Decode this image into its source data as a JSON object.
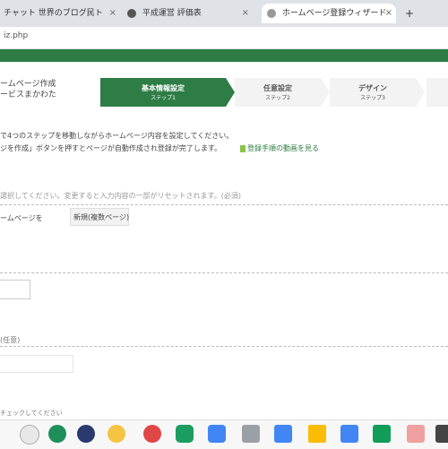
{
  "browser": {
    "tabs": [
      {
        "title": "チャット 世界のブログ民ト"
      },
      {
        "title": "平成運営 評価表"
      },
      {
        "title": "ホームページ登録ウィザード"
      }
    ],
    "new_tab": "+",
    "url": "iz.php"
  },
  "header": {
    "site_title_line1": "ームページ作成",
    "site_title_line2": "ービスまかわた",
    "steps": [
      {
        "label": "基本情報設定",
        "sub": "ステップ1"
      },
      {
        "label": "任意設定",
        "sub": "ステップ2"
      },
      {
        "label": "デザイン",
        "sub": "ステップ3"
      }
    ]
  },
  "intro": {
    "line1": "で4つのステップを移動しながらホームページ内容を設定してください。",
    "line2": "ジを作成」ボタンを押すとページが自動作成され登録が完了します。",
    "sample_link": "登録手順の動画を見る"
  },
  "form": {
    "note": "選択してください。変更すると入力内容の一部がリセットされます。(必須)",
    "homepage_label": "ームページを",
    "homepage_value": "新規(複数ページ)",
    "section_label": "(任意)",
    "check_note": "チェックしてください"
  },
  "colors": {
    "accent": "#2e7d46"
  }
}
